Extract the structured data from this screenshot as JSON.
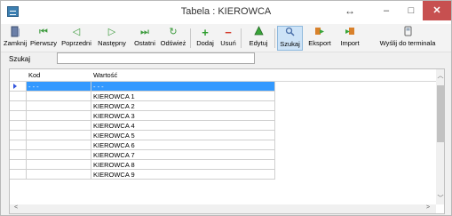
{
  "window": {
    "title": "Tabela : KIEROWCA",
    "resize_glyph": "↔",
    "minimize_glyph": "–",
    "maximize_glyph": "□",
    "close_glyph": "✕"
  },
  "toolbar": {
    "close_label": "Zamknij",
    "first_label": "Pierwszy",
    "prev_label": "Poprzedni",
    "next_label": "Następny",
    "last_label": "Ostatni",
    "refresh_label": "Odśwież",
    "add_label": "Dodaj",
    "delete_label": "Usuń",
    "edit_label": "Edytuj",
    "search_label": "Szukaj",
    "export_label": "Eksport",
    "import_label": "Import",
    "send_label": "Wyślij do terminala"
  },
  "search": {
    "label": "Szukaj",
    "value": "",
    "placeholder": ""
  },
  "grid": {
    "columns": [
      "Kod",
      "Wartość"
    ],
    "rows": [
      {
        "kod": "- - -",
        "wartosc": "- - -",
        "selected": true
      },
      {
        "kod": "",
        "wartosc": "KIEROWCA 1"
      },
      {
        "kod": "",
        "wartosc": "KIEROWCA 2"
      },
      {
        "kod": "",
        "wartosc": "KIEROWCA 3"
      },
      {
        "kod": "",
        "wartosc": "KIEROWCA 4"
      },
      {
        "kod": "",
        "wartosc": "KIEROWCA 5"
      },
      {
        "kod": "",
        "wartosc": "KIEROWCA 6"
      },
      {
        "kod": "",
        "wartosc": "KIEROWCA 7"
      },
      {
        "kod": "",
        "wartosc": "KIEROWCA 8"
      },
      {
        "kod": "",
        "wartosc": "KIEROWCA 9"
      }
    ]
  },
  "colors": {
    "selection": "#3399ff",
    "close_button": "#c75050",
    "active_tool": "#cde3f7"
  }
}
